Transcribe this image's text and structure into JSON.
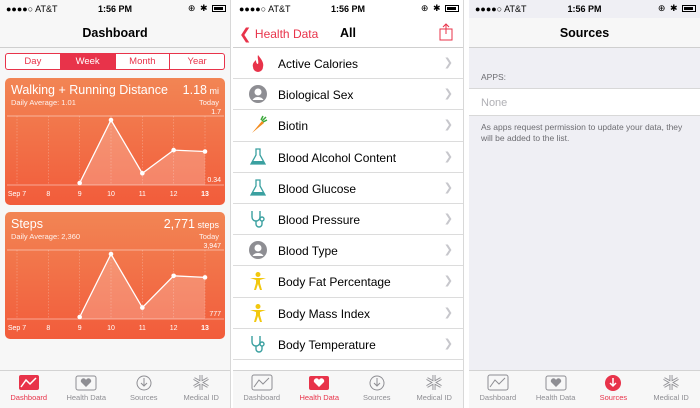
{
  "status": {
    "carrier": "●●●●○ AT&T",
    "time": "1:56 PM"
  },
  "dashboard": {
    "title": "Dashboard",
    "segments": [
      "Day",
      "Week",
      "Month",
      "Year"
    ],
    "active_segment": "Week"
  },
  "chart_data": [
    {
      "type": "line",
      "title": "Walking + Running Distance",
      "value": "1.18",
      "unit": "mi",
      "subtitle": "Daily Average: 1.01",
      "today_label": "Today",
      "categories": [
        "Sep 7",
        "8",
        "9",
        "10",
        "11",
        "12",
        "13"
      ],
      "series": [
        {
          "values": [
            null,
            null,
            0.34,
            1.7,
            0.55,
            1.05,
            1.02
          ]
        }
      ],
      "ymax_label": "1.7",
      "ymin_label": "0.34",
      "ylim": [
        0.34,
        1.7
      ]
    },
    {
      "type": "line",
      "title": "Steps",
      "value": "2,771",
      "unit": "steps",
      "subtitle": "Daily Average: 2,360",
      "today_label": "Today",
      "categories": [
        "Sep 7",
        "8",
        "9",
        "10",
        "11",
        "12",
        "13"
      ],
      "series": [
        {
          "values": [
            null,
            null,
            777,
            3947,
            1250,
            2850,
            2771
          ]
        }
      ],
      "ymax_label": "3,947",
      "ymin_label": "777",
      "ylim": [
        777,
        3947
      ]
    }
  ],
  "health_data": {
    "back_label": "Health Data",
    "title": "All",
    "items": [
      {
        "label": "Active Calories",
        "icon": "flame-icon"
      },
      {
        "label": "Biological Sex",
        "icon": "person-icon"
      },
      {
        "label": "Biotin",
        "icon": "carrot-icon"
      },
      {
        "label": "Blood Alcohol Content",
        "icon": "flask-icon"
      },
      {
        "label": "Blood Glucose",
        "icon": "flask-icon"
      },
      {
        "label": "Blood Pressure",
        "icon": "stethoscope-icon"
      },
      {
        "label": "Blood Type",
        "icon": "person-icon"
      },
      {
        "label": "Body Fat Percentage",
        "icon": "body-icon"
      },
      {
        "label": "Body Mass Index",
        "icon": "body-icon"
      },
      {
        "label": "Body Temperature",
        "icon": "stethoscope-icon"
      }
    ]
  },
  "sources": {
    "title": "Sources",
    "section_header": "APPS:",
    "none_label": "None",
    "note": "As apps request permission to update your data, they will be added to the list."
  },
  "tabs": [
    "Dashboard",
    "Health Data",
    "Sources",
    "Medical ID"
  ],
  "colors": {
    "accent": "#e8334a",
    "card_top": "#f28554",
    "card_bottom": "#f25c3b"
  }
}
